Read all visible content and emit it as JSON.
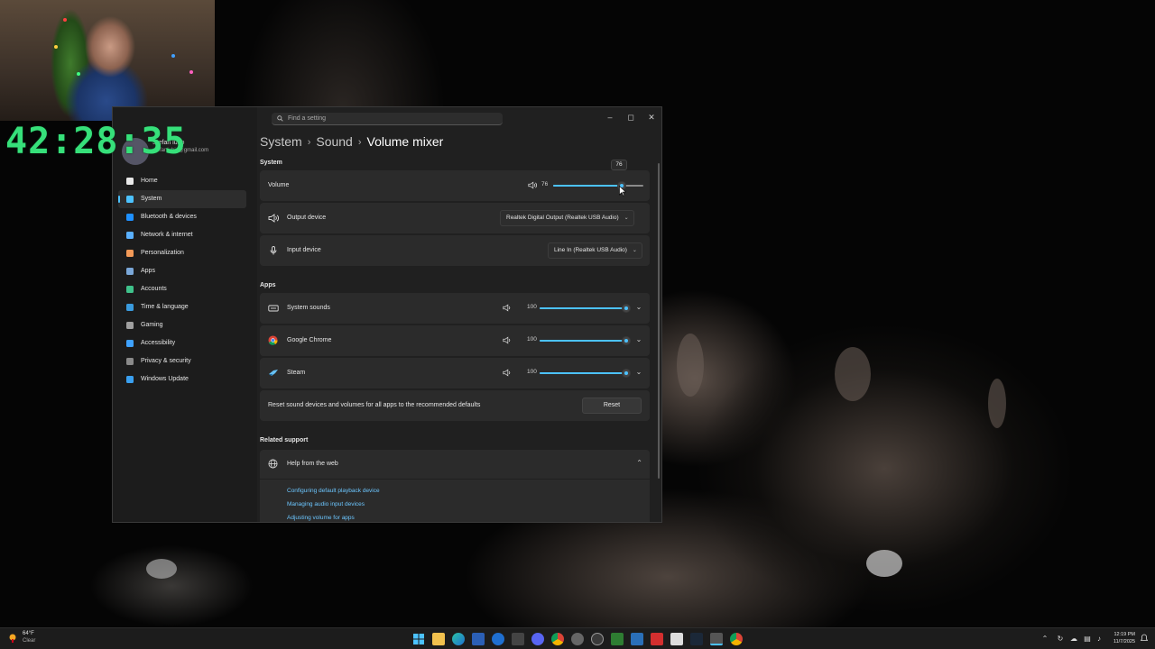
{
  "overlay": {
    "timer": "42:28:35"
  },
  "search": {
    "placeholder": "Find a setting"
  },
  "user": {
    "name": "Stefan lubo",
    "email": "stefanlubic@gmail.com"
  },
  "sidebar": {
    "items": [
      {
        "label": "Home",
        "icon": "home-icon",
        "color": "#e8e8e8"
      },
      {
        "label": "System",
        "icon": "monitor-icon",
        "color": "#4cc2ff",
        "active": true
      },
      {
        "label": "Bluetooth & devices",
        "icon": "bluetooth-icon",
        "color": "#1e90ff"
      },
      {
        "label": "Network & internet",
        "icon": "wifi-icon",
        "color": "#5ab0ff"
      },
      {
        "label": "Personalization",
        "icon": "brush-icon",
        "color": "#f39a58"
      },
      {
        "label": "Apps",
        "icon": "apps-icon",
        "color": "#7aa7d8"
      },
      {
        "label": "Accounts",
        "icon": "person-icon",
        "color": "#3fc28b"
      },
      {
        "label": "Time & language",
        "icon": "globe-clock-icon",
        "color": "#3a9bde"
      },
      {
        "label": "Gaming",
        "icon": "gamepad-icon",
        "color": "#a0a0a0"
      },
      {
        "label": "Accessibility",
        "icon": "accessibility-icon",
        "color": "#3fa2ff"
      },
      {
        "label": "Privacy & security",
        "icon": "shield-icon",
        "color": "#8a8a8a"
      },
      {
        "label": "Windows Update",
        "icon": "update-icon",
        "color": "#3aa0f0"
      }
    ]
  },
  "breadcrumb": {
    "system": "System",
    "sound": "Sound",
    "current": "Volume mixer"
  },
  "system_section": {
    "title": "System",
    "volume": {
      "label": "Volume",
      "value": 76,
      "value_text": "76",
      "tooltip": "76"
    },
    "output": {
      "label": "Output device",
      "selected": "Realtek Digital Output (Realtek USB Audio)"
    },
    "input": {
      "label": "Input device",
      "selected": "Line In (Realtek USB Audio)"
    }
  },
  "apps_section": {
    "title": "Apps",
    "apps": [
      {
        "name": "System sounds",
        "icon": "system-sounds-icon",
        "volume": 100,
        "volume_text": "100"
      },
      {
        "name": "Google Chrome",
        "icon": "chrome-icon",
        "volume": 100,
        "volume_text": "100"
      },
      {
        "name": "Steam",
        "icon": "steam-icon",
        "volume": 100,
        "volume_text": "100"
      }
    ],
    "reset_text": "Reset sound devices and volumes for all apps to the recommended defaults",
    "reset_button": "Reset"
  },
  "support": {
    "title": "Related support",
    "help_header": "Help from the web",
    "links": [
      "Configuring default playback device",
      "Managing audio input devices",
      "Adjusting volume for apps"
    ]
  },
  "taskbar": {
    "weather_temp": "64°F",
    "weather_cond": "Clear",
    "time": "12:19 PM",
    "date": "11/7/2025"
  },
  "colors": {
    "accent": "#4cc2ff",
    "timer": "#36e07a",
    "window_bg": "#202020",
    "card_bg": "#2b2b2b"
  }
}
